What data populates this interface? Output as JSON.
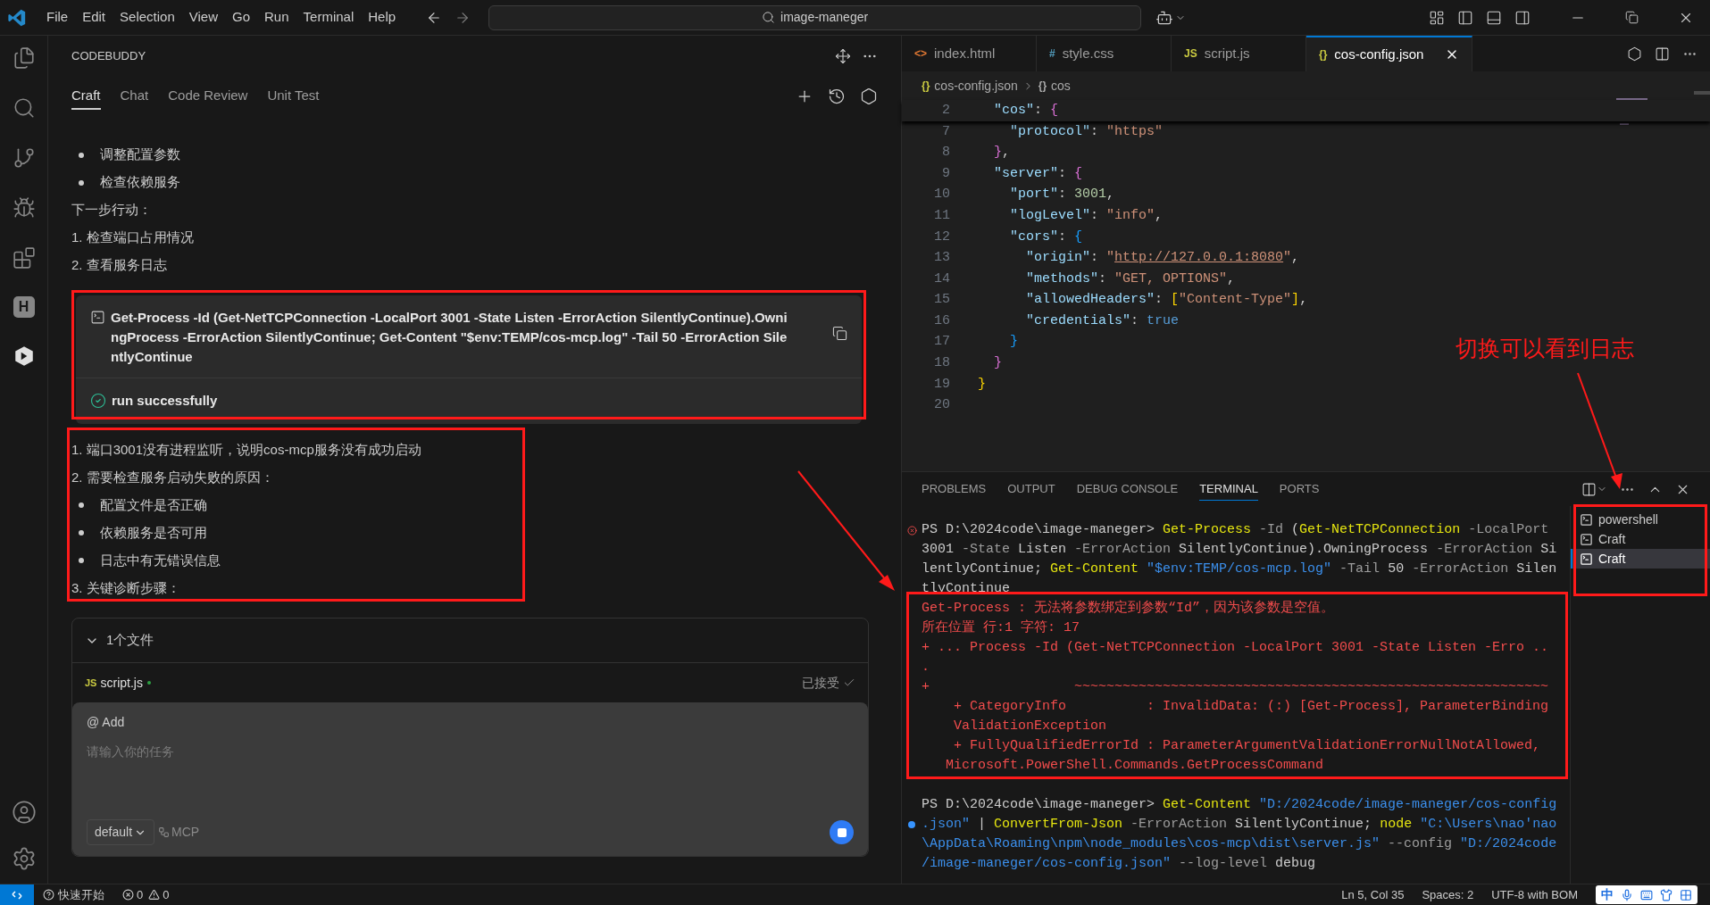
{
  "title_bar": {
    "menu": [
      "File",
      "Edit",
      "Selection",
      "View",
      "Go",
      "Run",
      "Terminal",
      "Help"
    ],
    "search": "image-maneger"
  },
  "activity_bar": {
    "extension_letter": "H"
  },
  "side_panel": {
    "title": "CODEBUDDY",
    "tabs": [
      {
        "label": "Craft",
        "selected": true
      },
      {
        "label": "Chat",
        "selected": false
      },
      {
        "label": "Code Review",
        "selected": false
      },
      {
        "label": "Unit Test",
        "selected": false
      }
    ],
    "messages": [
      {
        "kind": "bullet",
        "text": "调整配置参数"
      },
      {
        "kind": "bullet",
        "text": "检查依赖服务"
      },
      {
        "kind": "plain",
        "text": "下一步行动："
      },
      {
        "kind": "plain",
        "text": "1. 检查端口占用情况"
      },
      {
        "kind": "plain",
        "text": "2. 查看服务日志"
      }
    ],
    "command_card": {
      "command": "Get-Process -Id (Get-NetTCPConnection -LocalPort 3001 -State Listen -ErrorAction SilentlyContinue).OwningProcess -ErrorAction SilentlyContinue; Get-Content \"$env:TEMP/cos-mcp.log\" -Tail 50 -ErrorAction SilentlyContinue",
      "status": "run successfully"
    },
    "messages_after": [
      {
        "kind": "plain",
        "text": "1. 端口3001没有进程监听，说明cos-mcp服务没有成功启动"
      },
      {
        "kind": "plain",
        "text": "2. 需要检查服务启动失败的原因："
      },
      {
        "kind": "bullet",
        "text": "配置文件是否正确"
      },
      {
        "kind": "bullet",
        "text": "依赖服务是否可用"
      },
      {
        "kind": "bullet",
        "text": "日志中有无错误信息"
      },
      {
        "kind": "plain",
        "text": "3. 关键诊断步骤："
      }
    ],
    "files": {
      "header": "1个文件",
      "expanded": true,
      "items": [
        {
          "icon": "JS",
          "name": "script.js",
          "status": "已接受"
        }
      ]
    },
    "input": {
      "mention": "@ Add",
      "placeholder": "请输入你的任务",
      "mode": "default",
      "mcp": "MCP"
    }
  },
  "editor": {
    "tabs": [
      {
        "icon": "<>",
        "label": "index.html",
        "selected": false
      },
      {
        "icon": "#",
        "label": "style.css",
        "selected": false
      },
      {
        "icon": "JS",
        "label": "script.js",
        "selected": false
      },
      {
        "icon": "{}",
        "label": "cos-config.json",
        "selected": true
      }
    ],
    "breadcrumb": [
      {
        "icon": "{}",
        "label": "cos-config.json"
      },
      {
        "icon": "{}",
        "label": "cos"
      }
    ],
    "sticky_line": {
      "number": "2",
      "tokens": [
        {
          "text": "  \"cos\"",
          "kind": "key"
        },
        {
          "text": ": ",
          "kind": "punct"
        },
        {
          "text": "{",
          "kind": "bracket2"
        }
      ]
    },
    "lines": [
      {
        "number": "7",
        "tokens": [
          {
            "text": "    \"protocol\"",
            "kind": "key"
          },
          {
            "text": ": ",
            "kind": "punct"
          },
          {
            "text": "\"https\"",
            "kind": "string"
          }
        ]
      },
      {
        "number": "8",
        "tokens": [
          {
            "text": "  }",
            "kind": "bracket2"
          },
          {
            "text": ",",
            "kind": "punct"
          }
        ]
      },
      {
        "number": "9",
        "tokens": [
          {
            "text": "  \"server\"",
            "kind": "key"
          },
          {
            "text": ": ",
            "kind": "punct"
          },
          {
            "text": "{",
            "kind": "bracket2"
          }
        ]
      },
      {
        "number": "10",
        "tokens": [
          {
            "text": "    \"port\"",
            "kind": "key"
          },
          {
            "text": ": ",
            "kind": "punct"
          },
          {
            "text": "3001",
            "kind": "number"
          },
          {
            "text": ",",
            "kind": "punct"
          }
        ]
      },
      {
        "number": "11",
        "tokens": [
          {
            "text": "    \"logLevel\"",
            "kind": "key"
          },
          {
            "text": ": ",
            "kind": "punct"
          },
          {
            "text": "\"info\"",
            "kind": "string"
          },
          {
            "text": ",",
            "kind": "punct"
          }
        ]
      },
      {
        "number": "12",
        "tokens": [
          {
            "text": "    \"cors\"",
            "kind": "key"
          },
          {
            "text": ": ",
            "kind": "punct"
          },
          {
            "text": "{",
            "kind": "bracket3"
          }
        ]
      },
      {
        "number": "13",
        "tokens": [
          {
            "text": "      \"origin\"",
            "kind": "key"
          },
          {
            "text": ": ",
            "kind": "punct"
          },
          {
            "text": "\"",
            "kind": "string"
          },
          {
            "text": "http://127.0.0.1:8080",
            "kind": "link"
          },
          {
            "text": "\"",
            "kind": "string"
          },
          {
            "text": ",",
            "kind": "punct"
          }
        ]
      },
      {
        "number": "14",
        "tokens": [
          {
            "text": "      \"methods\"",
            "kind": "key"
          },
          {
            "text": ": ",
            "kind": "punct"
          },
          {
            "text": "\"GET, OPTIONS\"",
            "kind": "string"
          },
          {
            "text": ",",
            "kind": "punct"
          }
        ]
      },
      {
        "number": "15",
        "tokens": [
          {
            "text": "      \"allowedHeaders\"",
            "kind": "key"
          },
          {
            "text": ": ",
            "kind": "punct"
          },
          {
            "text": "[",
            "kind": "bracket1"
          },
          {
            "text": "\"Content-Type\"",
            "kind": "string"
          },
          {
            "text": "]",
            "kind": "bracket1"
          },
          {
            "text": ",",
            "kind": "punct"
          }
        ]
      },
      {
        "number": "16",
        "tokens": [
          {
            "text": "      \"credentials\"",
            "kind": "key"
          },
          {
            "text": ": ",
            "kind": "punct"
          },
          {
            "text": "true",
            "kind": "keyword"
          }
        ]
      },
      {
        "number": "17",
        "tokens": [
          {
            "text": "    }",
            "kind": "bracket3"
          }
        ]
      },
      {
        "number": "18",
        "tokens": [
          {
            "text": "  }",
            "kind": "bracket2"
          }
        ]
      },
      {
        "number": "19",
        "tokens": [
          {
            "text": "}",
            "kind": "bracket1"
          }
        ]
      },
      {
        "number": "20"
      }
    ]
  },
  "panel": {
    "tabs": [
      {
        "label": "PROBLEMS",
        "selected": false
      },
      {
        "label": "OUTPUT",
        "selected": false
      },
      {
        "label": "DEBUG CONSOLE",
        "selected": false
      },
      {
        "label": "TERMINAL",
        "selected": true
      },
      {
        "label": "PORTS",
        "selected": false
      }
    ],
    "terminal_lines": [
      {
        "error_mark": true,
        "busy_mark": false,
        "tokens": [
          {
            "text": "PS D:\\2024code\\image-maneger> ",
            "kind": "plain"
          },
          {
            "text": "Get-Process",
            "kind": "cmd"
          },
          {
            "text": " -Id ",
            "kind": "param"
          },
          {
            "text": "(",
            "kind": "plain"
          },
          {
            "text": "Get-NetTCPConnection",
            "kind": "cmd"
          },
          {
            "text": " -LocalPort",
            "kind": "param"
          }
        ]
      },
      {
        "error_mark": false,
        "busy_mark": false,
        "tokens": [
          {
            "text": "3001",
            "kind": "plain"
          },
          {
            "text": " -State",
            "kind": "param"
          },
          {
            "text": " Listen",
            "kind": "plain"
          },
          {
            "text": " -ErrorAction",
            "kind": "param"
          },
          {
            "text": " SilentlyContinue).OwningProcess",
            "kind": "plain"
          },
          {
            "text": " -ErrorAction",
            "kind": "param"
          },
          {
            "text": " Si",
            "kind": "plain"
          }
        ]
      },
      {
        "error_mark": false,
        "busy_mark": false,
        "tokens": [
          {
            "text": "lentlyContinue; ",
            "kind": "plain"
          },
          {
            "text": "Get-Content",
            "kind": "cmd"
          },
          {
            "text": " \"$env:TEMP/cos-mcp.log\"",
            "kind": "string"
          },
          {
            "text": " -Tail",
            "kind": "param"
          },
          {
            "text": " 50",
            "kind": "plain"
          },
          {
            "text": " -ErrorAction",
            "kind": "param"
          },
          {
            "text": " Silen",
            "kind": "plain"
          }
        ]
      },
      {
        "error_mark": false,
        "busy_mark": false,
        "tokens": [
          {
            "text": "tlyContinue",
            "kind": "plain"
          }
        ]
      },
      {
        "error_mark": false,
        "busy_mark": false,
        "tokens": [
          {
            "text": "Get-Process : 无法将参数绑定到参数“Id”，因为该参数是空值。",
            "kind": "error"
          }
        ]
      },
      {
        "error_mark": false,
        "busy_mark": false,
        "tokens": [
          {
            "text": "所在位置 行:1 字符: 17",
            "kind": "error"
          }
        ]
      },
      {
        "error_mark": false,
        "busy_mark": false,
        "tokens": [
          {
            "text": "+ ... Process -Id (Get-NetTCPConnection -LocalPort 3001 -State Listen -Erro ..",
            "kind": "error"
          }
        ]
      },
      {
        "error_mark": false,
        "busy_mark": false,
        "tokens": [
          {
            "text": ".",
            "kind": "error"
          }
        ]
      },
      {
        "error_mark": false,
        "busy_mark": false,
        "tokens": [
          {
            "text": "+                  ~~~~~~~~~~~~~~~~~~~~~~~~~~~~~~~~~~~~~~~~~~~~~~~~~~~~~~~~~~~",
            "kind": "error"
          }
        ]
      },
      {
        "error_mark": false,
        "busy_mark": false,
        "tokens": [
          {
            "text": "    + CategoryInfo          : InvalidData: (:) [Get-Process], ParameterBinding",
            "kind": "error"
          }
        ]
      },
      {
        "error_mark": false,
        "busy_mark": false,
        "tokens": [
          {
            "text": "    ValidationException",
            "kind": "error"
          }
        ]
      },
      {
        "error_mark": false,
        "busy_mark": false,
        "tokens": [
          {
            "text": "    + FullyQualifiedErrorId : ParameterArgumentValidationErrorNullNotAllowed,",
            "kind": "error"
          }
        ]
      },
      {
        "error_mark": false,
        "busy_mark": false,
        "tokens": [
          {
            "text": "   Microsoft.PowerShell.Commands.GetProcessCommand",
            "kind": "error"
          }
        ]
      },
      {
        "error_mark": false,
        "busy_mark": false
      },
      {
        "error_mark": false,
        "busy_mark": false,
        "tokens": [
          {
            "text": "PS D:\\2024code\\image-maneger> ",
            "kind": "plain"
          },
          {
            "text": "Get-Content",
            "kind": "cmd"
          },
          {
            "text": " \"D:/2024code/image-maneger/cos-config",
            "kind": "string"
          }
        ]
      },
      {
        "error_mark": false,
        "busy_mark": true,
        "tokens": [
          {
            "text": ".json\"",
            "kind": "string"
          },
          {
            "text": " | ",
            "kind": "plain"
          },
          {
            "text": "ConvertFrom-Json",
            "kind": "cmd"
          },
          {
            "text": " -ErrorAction",
            "kind": "param"
          },
          {
            "text": " SilentlyContinue; ",
            "kind": "plain"
          },
          {
            "text": "node",
            "kind": "cmd"
          },
          {
            "text": " \"C:\\Users\\nao'nao",
            "kind": "string"
          }
        ]
      },
      {
        "error_mark": false,
        "busy_mark": false,
        "tokens": [
          {
            "text": "\\AppData\\Roaming\\npm\\node_modules\\cos-mcp\\dist\\server.js\"",
            "kind": "string"
          },
          {
            "text": " --config",
            "kind": "param"
          },
          {
            "text": " \"D:/2024code",
            "kind": "string"
          }
        ]
      },
      {
        "error_mark": false,
        "busy_mark": false,
        "tokens": [
          {
            "text": "/image-maneger/cos-config.json\"",
            "kind": "string"
          },
          {
            "text": " --log-level",
            "kind": "param"
          },
          {
            "text": " debug",
            "kind": "plain"
          }
        ]
      }
    ],
    "terminals": [
      {
        "name": "powershell",
        "selected": false
      },
      {
        "name": "Craft",
        "selected": false
      },
      {
        "name": "Craft",
        "selected": true
      }
    ]
  },
  "status_bar": {
    "quick_start": "快速开始",
    "errors": "0",
    "warnings": "0",
    "right": [
      "Ln 5, Col 35",
      "Spaces: 2",
      "UTF-8 with BOM"
    ],
    "ime": "中"
  },
  "annotation": {
    "note": "切换可以看到日志"
  }
}
